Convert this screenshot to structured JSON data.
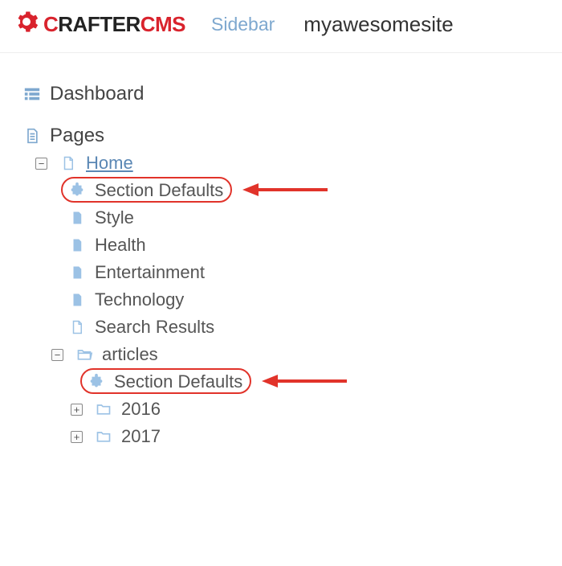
{
  "header": {
    "brand_left": "C",
    "brand_mid": "RAFTER",
    "brand_right": "CMS",
    "sidebar_label": "Sidebar",
    "site_name": "myawesomesite"
  },
  "nav": {
    "dashboard": "Dashboard",
    "pages": "Pages",
    "home": "Home",
    "section_defaults_1": "Section Defaults",
    "style": "Style",
    "health": "Health",
    "entertainment": "Entertainment",
    "technology": "Technology",
    "search_results": "Search Results",
    "articles": "articles",
    "section_defaults_2": "Section Defaults",
    "y2016": "2016",
    "y2017": "2017"
  }
}
